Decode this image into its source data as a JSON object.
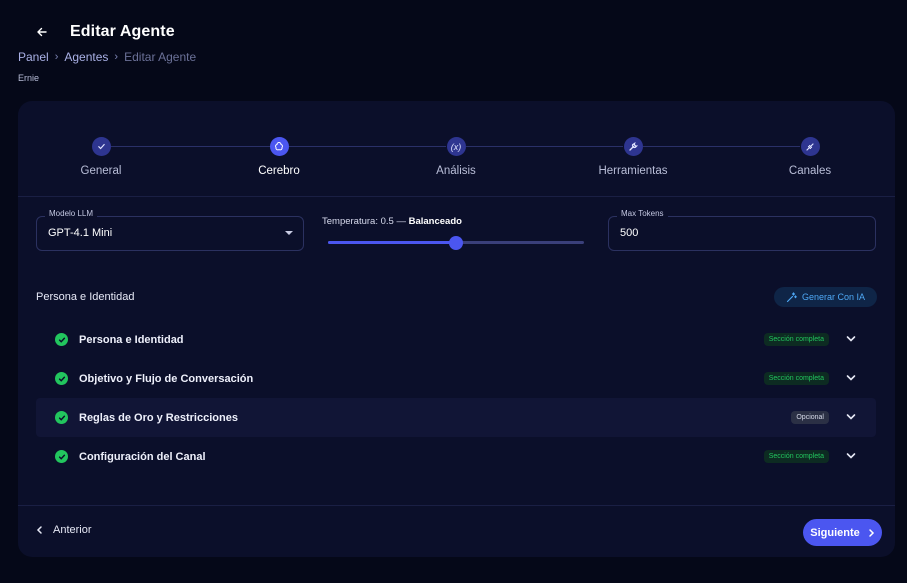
{
  "header": {
    "title": "Editar Agente",
    "agent_name": "Ernie"
  },
  "breadcrumb": [
    {
      "label": "Panel"
    },
    {
      "label": "Agentes"
    },
    {
      "label": "Editar Agente"
    }
  ],
  "stepper": {
    "active_index": 1,
    "steps": [
      {
        "label": "General",
        "icon": "check-icon"
      },
      {
        "label": "Cerebro",
        "icon": "brain-icon"
      },
      {
        "label": "Análisis",
        "icon": "function-icon"
      },
      {
        "label": "Herramientas",
        "icon": "wrench-icon"
      },
      {
        "label": "Canales",
        "icon": "plug-icon"
      }
    ]
  },
  "model_field": {
    "label": "Modelo LLM",
    "value": "GPT-4.1 Mini"
  },
  "temperature": {
    "prefix": "Temperatura: 0.5 — ",
    "mode": "Balanceado",
    "value": 0.5
  },
  "max_tokens": {
    "label": "Max Tokens",
    "value": "500"
  },
  "persona": {
    "section_title": "Persona e Identidad",
    "generate_label": "Generar Con IA",
    "rows": [
      {
        "label": "Persona e Identidad",
        "badge": "Sección completa",
        "status": "complete"
      },
      {
        "label": "Objetivo y Flujo de Conversación",
        "badge": "Sección completa",
        "status": "complete"
      },
      {
        "label": "Reglas de Oro y Restricciones",
        "badge": "Opcional",
        "status": "optional"
      },
      {
        "label": "Configuración del Canal",
        "badge": "Sección completa",
        "status": "complete"
      }
    ]
  },
  "footer": {
    "prev_label": "Anterior",
    "next_label": "Siguiente"
  },
  "colors": {
    "accent": "#4b56f0",
    "success": "#22c55e",
    "background": "#050818",
    "card": "#0b0f2a"
  }
}
